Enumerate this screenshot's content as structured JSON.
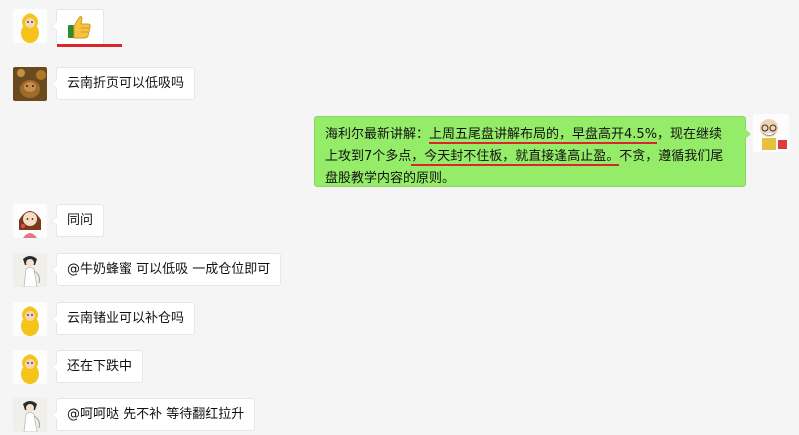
{
  "colors": {
    "background": "#f5f5f5",
    "bubble_white": "#ffffff",
    "bubble_green": "#95ec69",
    "annotation_red": "#d9262c"
  },
  "messages": [
    {
      "side": "left",
      "avatar": "yellow-cartoon-avatar-icon",
      "content": "thumbs-up-emoji-icon"
    },
    {
      "side": "left",
      "avatar": "dog-photo-avatar-icon",
      "text": "云南折页可以低吸吗"
    },
    {
      "side": "right",
      "avatar": "old-man-cartoon-avatar-icon",
      "segments": {
        "s1": "海利尔最新讲解：",
        "s2": "上周五尾盘讲解布局的，早盘高开4.5%",
        "s3": "，现在继续上攻到7个多点",
        "s4": "，今天封不住板，就直接逢高止盈。",
        "s5": "不贪，遵循我们尾盘股教学内容的原则。"
      }
    },
    {
      "side": "left",
      "avatar": "girl-cartoon-avatar-icon",
      "text": "同问"
    },
    {
      "side": "left",
      "avatar": "painted-lady-avatar-icon",
      "text": "@牛奶蜂蜜 可以低吸 一成仓位即可"
    },
    {
      "side": "left",
      "avatar": "yellow-cartoon-avatar-icon",
      "text": "云南锗业可以补仓吗"
    },
    {
      "side": "left",
      "avatar": "yellow-cartoon-avatar-icon",
      "text": "还在下跌中"
    },
    {
      "side": "left",
      "avatar": "painted-lady-avatar-icon",
      "text": "@呵呵哒 先不补  等待翻红拉升"
    }
  ]
}
